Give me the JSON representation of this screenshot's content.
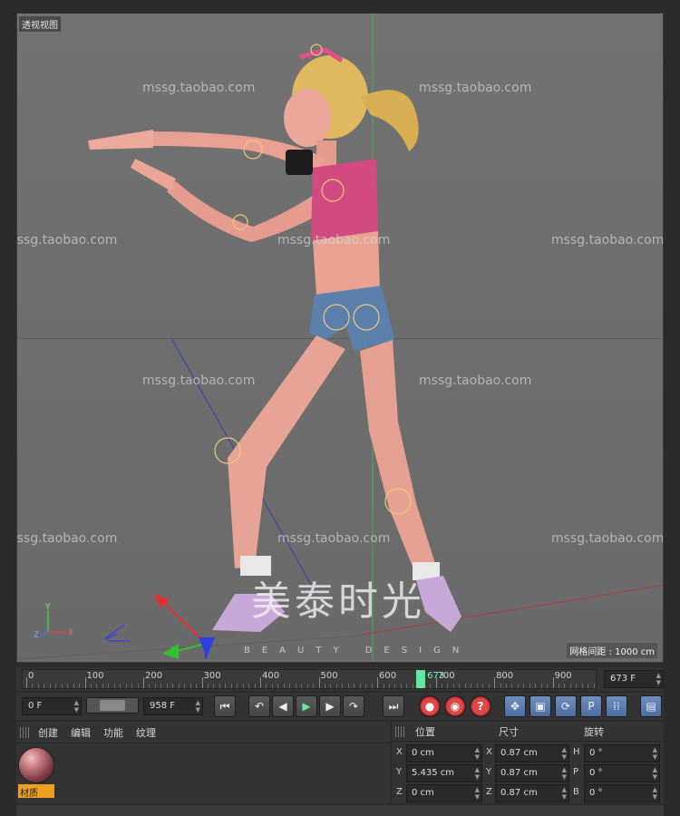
{
  "viewport": {
    "title": "透视视图",
    "grid_spacing_label": "网格间距 : 1000 cm",
    "watermark_text": "mssg.taobao.com",
    "logo_cn": "美泰时光",
    "logo_en": "BEAUTY DESIGN",
    "axis_labels": {
      "x": "X",
      "y": "Y",
      "z": "Z"
    }
  },
  "timeline": {
    "ticks": [
      "0",
      "100",
      "200",
      "300",
      "400",
      "500",
      "600",
      "700",
      "800",
      "900"
    ],
    "current_frame_label": "673",
    "current_frame_value": 673,
    "max_frame": 958,
    "current_frame_field": "673 F"
  },
  "transport": {
    "start_field": "0 F",
    "end_field": "958 F",
    "buttons": {
      "goto_start": "⏮",
      "prev_key": "↶",
      "prev_frame": "◀",
      "play": "▶",
      "next_frame": "▶",
      "next_key": "↷",
      "goto_end": "⏭",
      "record": "●",
      "auto_key": "◉",
      "key_help": "?",
      "move": "✥",
      "scale": "▣",
      "rotate": "⟳",
      "param": "P",
      "grid_dots": "⁞⁞",
      "film": "▤"
    }
  },
  "material_panel": {
    "menu": [
      "创建",
      "编辑",
      "功能",
      "纹理"
    ],
    "material_name": "材质"
  },
  "attributes": {
    "headers": {
      "position": "位置",
      "size": "尺寸",
      "rotation": "旋转"
    },
    "rows": [
      {
        "pos_axis": "X",
        "pos_value": "0 cm",
        "size_axis": "X",
        "size_value": "0.87 cm",
        "rot_axis": "H",
        "rot_value": "0 °"
      },
      {
        "pos_axis": "Y",
        "pos_value": "5.435 cm",
        "size_axis": "Y",
        "size_value": "0.87 cm",
        "rot_axis": "P",
        "rot_value": "0 °"
      },
      {
        "pos_axis": "Z",
        "pos_value": "0 cm",
        "size_axis": "Z",
        "size_value": "0.87 cm",
        "rot_axis": "B",
        "rot_value": "0 °"
      }
    ]
  },
  "colors": {
    "accent_play": "#5ee8a0",
    "material_tag": "#f0a020",
    "record_red": "#e04848",
    "selected_tool": "#6f8fbf"
  }
}
